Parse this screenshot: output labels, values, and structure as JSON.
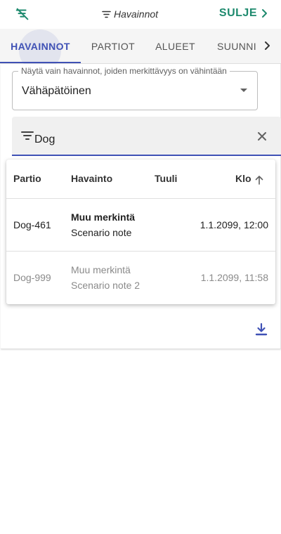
{
  "header": {
    "title": "Havainnot",
    "close_label": "SULJE"
  },
  "tabs": [
    {
      "label": "HAVAINNOT",
      "active": true
    },
    {
      "label": "PARTIOT",
      "active": false
    },
    {
      "label": "ALUEET",
      "active": false
    },
    {
      "label": "SUUNNI",
      "active": false
    }
  ],
  "significance_filter": {
    "label": "Näytä vain havainnot, joiden merkittävyys on vähintään",
    "value": "Vähäpätöinen"
  },
  "search": {
    "value": "Dog"
  },
  "table": {
    "columns": [
      "Partio",
      "Havainto",
      "Tuuli",
      "Klo"
    ],
    "sort_column": "Klo",
    "sort_direction": "ascending",
    "rows": [
      {
        "partio": "Dog-461",
        "havainto_type": "Muu merkintä",
        "havainto_note": "Scenario note",
        "tuuli": "",
        "klo": "1.1.2099, 12:00",
        "dimmed": false
      },
      {
        "partio": "Dog-999",
        "havainto_type": "Muu merkintä",
        "havainto_note": "Scenario note 2",
        "tuuli": "",
        "klo": "1.1.2099, 11:58",
        "dimmed": true
      }
    ]
  },
  "colors": {
    "accent": "#3f51b5",
    "close": "#1e8a6e",
    "tab_bar": "#f5f5f5"
  },
  "icons": [
    "filter-off-icon",
    "filter-icon",
    "chevron-right-icon",
    "caret-down-icon",
    "close-icon",
    "arrow-up-icon",
    "download-icon"
  ]
}
